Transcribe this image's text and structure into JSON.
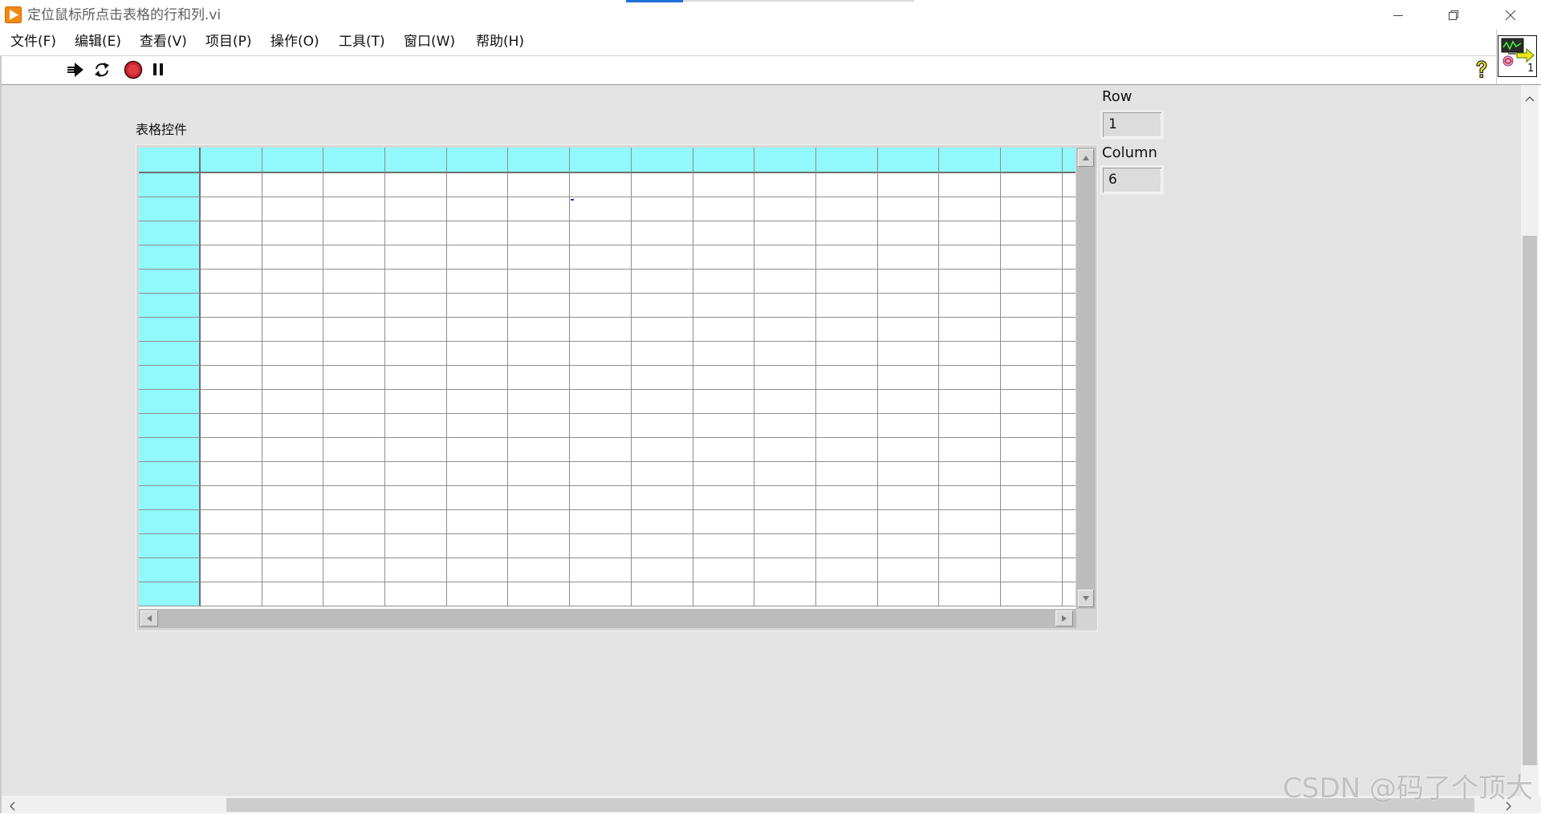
{
  "window": {
    "title": "定位鼠标所点击表格的行和列.vi",
    "app_icon": "labview-vi-icon",
    "controls": [
      "minimize-icon",
      "restore-icon",
      "close-icon"
    ]
  },
  "menu": {
    "items": [
      "文件(F)",
      "编辑(E)",
      "查看(V)",
      "项目(P)",
      "操作(O)",
      "工具(T)",
      "窗口(W)",
      "帮助(H)"
    ]
  },
  "toolbar": {
    "icons": [
      "run-icon",
      "run-continuously-icon",
      "abort-execution-icon",
      "pause-icon"
    ],
    "help_icon": "context-help-icon"
  },
  "vi_icon": {
    "icon": "vi-connector-icon",
    "label": "1"
  },
  "table": {
    "label": "表格控件",
    "column_headers": [
      "",
      "",
      "",
      "",
      "",
      "",
      "",
      "",
      "",
      "",
      "",
      "",
      "",
      "",
      ""
    ],
    "row_headers": [
      "",
      "",
      "",
      "",
      "",
      "",
      "",
      "",
      "",
      "",
      "",
      "",
      "",
      "",
      "",
      "",
      "",
      ""
    ],
    "cells": [
      [
        "",
        "",
        "",
        "",
        "",
        "",
        "",
        "",
        "",
        "",
        "",
        "",
        "",
        "",
        ""
      ],
      [
        "",
        "",
        "",
        "",
        "",
        "",
        "",
        "",
        "",
        "",
        "",
        "",
        "",
        "",
        ""
      ],
      [
        "",
        "",
        "",
        "",
        "",
        "",
        "",
        "",
        "",
        "",
        "",
        "",
        "",
        "",
        ""
      ],
      [
        "",
        "",
        "",
        "",
        "",
        "",
        "",
        "",
        "",
        "",
        "",
        "",
        "",
        "",
        ""
      ],
      [
        "",
        "",
        "",
        "",
        "",
        "",
        "",
        "",
        "",
        "",
        "",
        "",
        "",
        "",
        ""
      ],
      [
        "",
        "",
        "",
        "",
        "",
        "",
        "",
        "",
        "",
        "",
        "",
        "",
        "",
        "",
        ""
      ],
      [
        "",
        "",
        "",
        "",
        "",
        "",
        "",
        "",
        "",
        "",
        "",
        "",
        "",
        "",
        ""
      ],
      [
        "",
        "",
        "",
        "",
        "",
        "",
        "",
        "",
        "",
        "",
        "",
        "",
        "",
        "",
        ""
      ],
      [
        "",
        "",
        "",
        "",
        "",
        "",
        "",
        "",
        "",
        "",
        "",
        "",
        "",
        "",
        ""
      ],
      [
        "",
        "",
        "",
        "",
        "",
        "",
        "",
        "",
        "",
        "",
        "",
        "",
        "",
        "",
        ""
      ],
      [
        "",
        "",
        "",
        "",
        "",
        "",
        "",
        "",
        "",
        "",
        "",
        "",
        "",
        "",
        ""
      ],
      [
        "",
        "",
        "",
        "",
        "",
        "",
        "",
        "",
        "",
        "",
        "",
        "",
        "",
        "",
        ""
      ],
      [
        "",
        "",
        "",
        "",
        "",
        "",
        "",
        "",
        "",
        "",
        "",
        "",
        "",
        "",
        ""
      ],
      [
        "",
        "",
        "",
        "",
        "",
        "",
        "",
        "",
        "",
        "",
        "",
        "",
        "",
        "",
        ""
      ],
      [
        "",
        "",
        "",
        "",
        "",
        "",
        "",
        "",
        "",
        "",
        "",
        "",
        "",
        "",
        ""
      ],
      [
        "",
        "",
        "",
        "",
        "",
        "",
        "",
        "",
        "",
        "",
        "",
        "",
        "",
        "",
        ""
      ],
      [
        "",
        "",
        "",
        "",
        "",
        "",
        "",
        "",
        "",
        "",
        "",
        "",
        "",
        "",
        ""
      ],
      [
        "",
        "",
        "",
        "",
        "",
        "",
        "",
        "",
        "",
        "",
        "",
        "",
        "",
        "",
        ""
      ]
    ]
  },
  "indicators": {
    "row": {
      "label": "Row",
      "value": "1"
    },
    "column": {
      "label": "Column",
      "value": "6"
    }
  },
  "colors": {
    "table_header": "#91f8fb",
    "panel_background": "#e3e3e3",
    "abort_button": "#c9252b"
  },
  "watermark": "CSDN @码了个顶大"
}
